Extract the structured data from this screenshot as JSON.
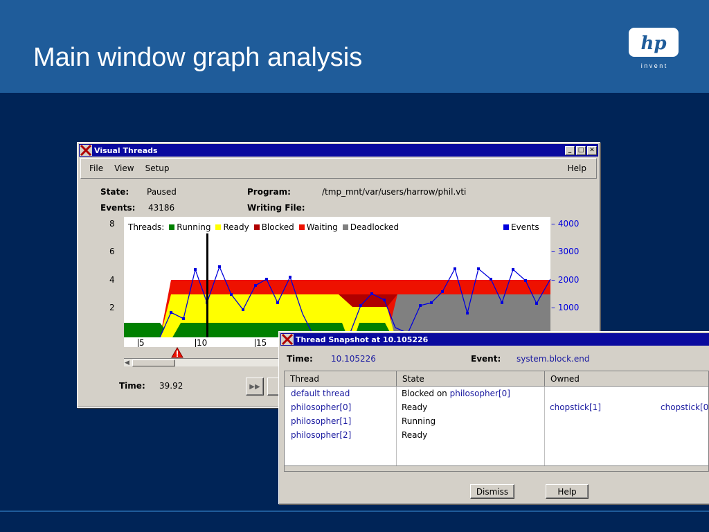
{
  "slide": {
    "title": "Main window graph analysis"
  },
  "logo": {
    "mark": "hp",
    "tagline": "i n v e n t"
  },
  "main_window": {
    "title": "Visual Threads",
    "menu": [
      "File",
      "View",
      "Setup"
    ],
    "menu_help": "Help",
    "state_label": "State:",
    "state_value": "Paused",
    "program_label": "Program:",
    "program_value": "/tmp_mnt/var/users/harrow/phil.vti",
    "events_label": "Events:",
    "events_value": "43186",
    "writing_label": "Writing File:",
    "time_label": "Time:",
    "time_value": "39.92",
    "play_icon": "fast-forward-icon",
    "legend": {
      "threads_label": "Threads:",
      "items": [
        {
          "label": "Running",
          "color": "#008000"
        },
        {
          "label": "Ready",
          "color": "#ffff00"
        },
        {
          "label": "Blocked",
          "color": "#b00000"
        },
        {
          "label": "Waiting",
          "color": "#ee1100"
        },
        {
          "label": "Deadlocked",
          "color": "#808080"
        }
      ],
      "events_label": "Events",
      "events_color": "#0000dd"
    },
    "left_axis": [
      "8",
      "6",
      "4",
      "2"
    ],
    "right_axis": [
      "4000",
      "3000",
      "2000",
      "1000"
    ],
    "time_ticks": [
      "5",
      "10",
      "15"
    ]
  },
  "snapshot_window": {
    "title": "Thread Snapshot at 10.105226",
    "time_label": "Time:",
    "time_value": "10.105226",
    "event_label": "Event:",
    "event_value": "system.block.end",
    "columns": [
      "Thread",
      "State",
      "Owned"
    ],
    "rows": [
      {
        "thread": "default thread",
        "state_prefix": "Blocked on ",
        "state_link": "philosopher[0]",
        "owned": [
          "",
          ""
        ]
      },
      {
        "thread": "philosopher[0]",
        "state_prefix": "Ready",
        "state_link": "",
        "owned": [
          "chopstick[1]",
          "chopstick[0"
        ]
      },
      {
        "thread": "philosopher[1]",
        "state_prefix": "Running",
        "state_link": "",
        "owned": [
          "",
          ""
        ]
      },
      {
        "thread": "philosopher[2]",
        "state_prefix": "Ready",
        "state_link": "",
        "owned": [
          "",
          ""
        ]
      }
    ],
    "dismiss_label": "Dismiss",
    "help_label": "Help"
  }
}
